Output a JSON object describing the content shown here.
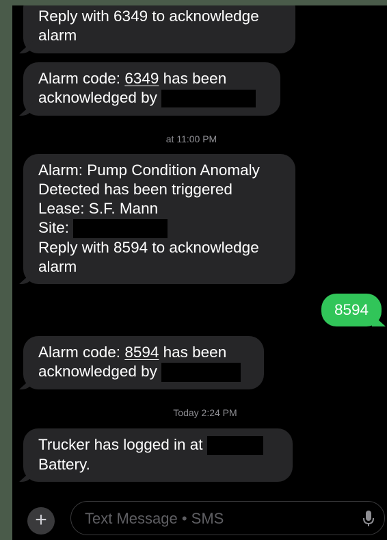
{
  "messages": [
    {
      "lines": [
        "Reply with 6349 to acknowledge",
        "alarm"
      ]
    },
    {
      "prefix": "Alarm code: ",
      "code": "6349",
      "suffix": " has been",
      "line2": "acknowledged by"
    },
    {
      "timestamp": "at 11:00 PM"
    },
    {
      "line1": "Alarm: Pump Condition Anomaly",
      "line2": "Detected has been triggered",
      "line3": "Lease: S.F. Mann",
      "line4": "Site:",
      "line5": "Reply with 8594 to acknowledge",
      "line6": "alarm"
    },
    {
      "outgoing": "8594"
    },
    {
      "prefix": "Alarm code: ",
      "code": "8594",
      "suffix": " has been",
      "line2": "acknowledged by"
    },
    {
      "timestamp": "Today 2:24 PM"
    },
    {
      "line1": "Trucker has logged in at",
      "line2": "Battery."
    }
  ],
  "composer": {
    "plus": "+",
    "placeholder": "Text Message • SMS"
  },
  "icons": {
    "add": "plus-icon",
    "dictation": "microphone-icon"
  },
  "colors": {
    "incoming_bubble": "#262628",
    "outgoing_bubble": "#31c559",
    "timestamp": "#8e8e93"
  }
}
